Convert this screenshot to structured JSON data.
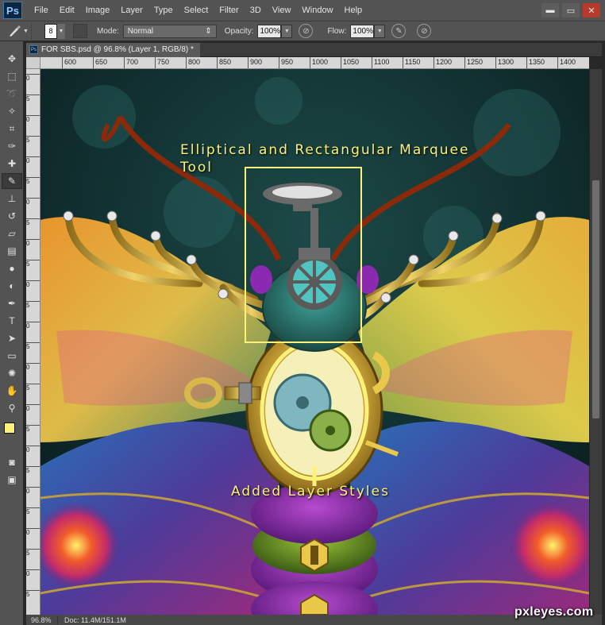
{
  "app": {
    "logo": "Ps"
  },
  "menu": [
    "File",
    "Edit",
    "Image",
    "Layer",
    "Type",
    "Select",
    "Filter",
    "3D",
    "View",
    "Window",
    "Help"
  ],
  "window_controls": {
    "minimize": "▬",
    "maximize": "▭",
    "close": "✕"
  },
  "options_bar": {
    "brush_size": "8",
    "mode_label": "Mode:",
    "mode_value": "Normal",
    "opacity_label": "Opacity:",
    "opacity_value": "100%",
    "flow_label": "Flow:",
    "flow_value": "100%"
  },
  "document": {
    "tab_title": "FOR SBS.psd @ 96.8% (Layer 1, RGB/8) *",
    "zoom": "96.8%",
    "doc_size": "Doc: 11.4M/151.1M"
  },
  "ruler": {
    "horizontal": [
      "600",
      "650",
      "700",
      "750",
      "800",
      "850",
      "900",
      "950",
      "1000",
      "1050",
      "1100",
      "1150",
      "1200",
      "1250",
      "1300",
      "1350",
      "1400"
    ],
    "vertical": [
      "0",
      "5",
      "0",
      "5",
      "0",
      "5",
      "0",
      "5",
      "0",
      "5",
      "0",
      "5",
      "0",
      "5",
      "0",
      "5",
      "0",
      "5",
      "0",
      "5",
      "0",
      "5",
      "0",
      "5",
      "0",
      "5"
    ]
  },
  "tools": [
    "move-tool",
    "marquee-tool",
    "lasso-tool",
    "magic-wand-tool",
    "crop-tool",
    "eyedropper-tool",
    "healing-brush-tool",
    "brush-tool",
    "clone-stamp-tool",
    "history-brush-tool",
    "eraser-tool",
    "gradient-tool",
    "blur-tool",
    "dodge-tool",
    "pen-tool",
    "type-tool",
    "path-selection-tool",
    "shape-tool",
    "3d-tool",
    "hand-tool",
    "zoom-tool"
  ],
  "colors": {
    "foreground": "#fbf27c",
    "background": "#000000",
    "annotation": "#fcf27b"
  },
  "annotations": {
    "marquee_title_line1": "Elliptical and Rectangular Marquee",
    "marquee_title_line2": "Tool",
    "layer_styles": "Added Layer Styles"
  },
  "watermark": "pxleyes.com"
}
